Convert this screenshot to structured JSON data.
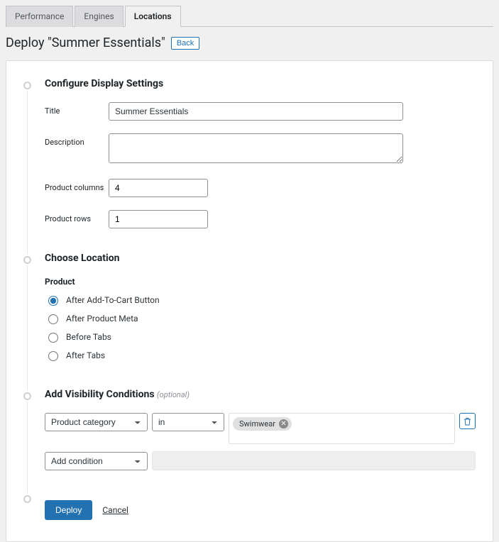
{
  "tabs": [
    {
      "label": "Performance",
      "active": false
    },
    {
      "label": "Engines",
      "active": false
    },
    {
      "label": "Locations",
      "active": true
    }
  ],
  "header": {
    "title": "Deploy \"Summer Essentials\"",
    "back": "Back"
  },
  "config": {
    "heading": "Configure Display Settings",
    "fields": {
      "title": {
        "label": "Title",
        "value": "Summer Essentials"
      },
      "description": {
        "label": "Description",
        "value": ""
      },
      "columns": {
        "label": "Product columns",
        "value": "4"
      },
      "rows": {
        "label": "Product rows",
        "value": "1"
      }
    }
  },
  "location": {
    "heading": "Choose Location",
    "group": "Product",
    "options": [
      {
        "label": "After Add-To-Cart Button",
        "checked": true
      },
      {
        "label": "After Product Meta",
        "checked": false
      },
      {
        "label": "Before Tabs",
        "checked": false
      },
      {
        "label": "After Tabs",
        "checked": false
      }
    ]
  },
  "visibility": {
    "heading": "Add Visibility Conditions",
    "optional": "(optional)",
    "condition": {
      "field": "Product category",
      "operator": "in",
      "values": [
        "Swimwear"
      ]
    },
    "add": "Add condition"
  },
  "actions": {
    "deploy": "Deploy",
    "cancel": "Cancel"
  }
}
